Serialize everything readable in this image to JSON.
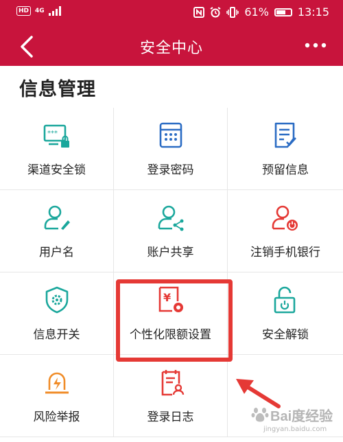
{
  "status_bar": {
    "network": "4G",
    "hd": "HD",
    "battery_percent_text": "61%",
    "battery_level": 0.61,
    "time": "13:15"
  },
  "app_bar": {
    "title": "安全中心"
  },
  "section": {
    "title": "信息管理"
  },
  "grid_items": [
    {
      "label": "渠道安全锁",
      "icon": "password-lock-icon",
      "color": "#1aa79c"
    },
    {
      "label": "登录密码",
      "icon": "keypad-icon",
      "color": "#2b6cc4"
    },
    {
      "label": "预留信息",
      "icon": "document-check-icon",
      "color": "#2b6cc4"
    },
    {
      "label": "用户名",
      "icon": "user-edit-icon",
      "color": "#1aa79c"
    },
    {
      "label": "账户共享",
      "icon": "user-share-icon",
      "color": "#1aa79c"
    },
    {
      "label": "注销手机银行",
      "icon": "user-power-icon",
      "color": "#e53935"
    },
    {
      "label": "信息开关",
      "icon": "shield-gear-icon",
      "color": "#1aa79c"
    },
    {
      "label": "个性化限额设置",
      "icon": "yuan-card-gear-icon",
      "color": "#e53935"
    },
    {
      "label": "安全解锁",
      "icon": "unlock-icon",
      "color": "#1aa79c"
    },
    {
      "label": "风险举报",
      "icon": "alarm-light-icon",
      "color": "#f08c28"
    },
    {
      "label": "登录日志",
      "icon": "log-clipboard-icon",
      "color": "#e53935"
    }
  ],
  "watermark": {
    "text": "Bai度经验",
    "url": "jingyan.baidu.com"
  }
}
